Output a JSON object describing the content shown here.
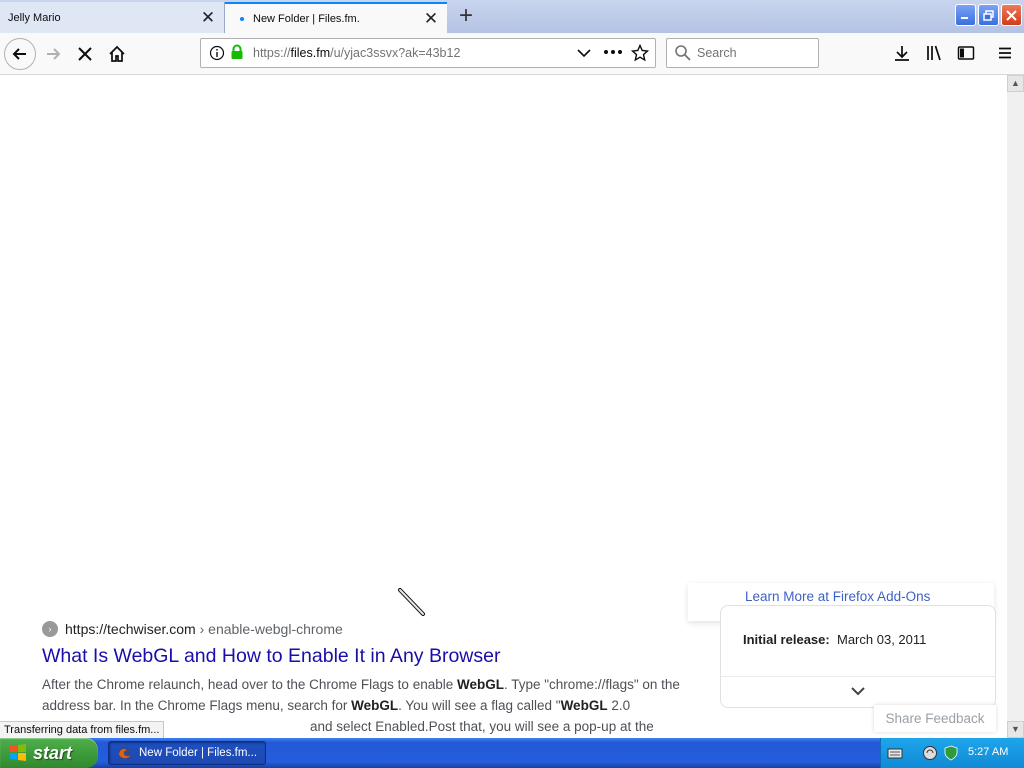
{
  "browser": {
    "tabs": [
      {
        "title": "Jelly Mario",
        "active": false
      },
      {
        "title": "New Folder | Files.fm.",
        "active": true,
        "loading": true
      }
    ],
    "url": {
      "prefix": "https://",
      "host": "files.fm",
      "path": "/u/yjac3ssvx?ak=43b12"
    },
    "search_placeholder": "Search",
    "status_text": "Transferring data from files.fm..."
  },
  "page": {
    "result": {
      "source": "https://techwiser.com",
      "breadcrumb": " › enable-webgl-chrome",
      "title": "What Is WebGL and How to Enable It in Any Browser",
      "snippet_parts": [
        {
          "text": "After the Chrome relaunch, head over to the Chrome Flags to enable ",
          "bold": false
        },
        {
          "text": "WebGL",
          "bold": true
        },
        {
          "text": ". Type \"chrome://flags\" on the address bar. In the Chrome Flags menu, search for ",
          "bold": false
        },
        {
          "text": "WebGL",
          "bold": true
        },
        {
          "text": ". You will see a flag called \"",
          "bold": false
        },
        {
          "text": "WebGL",
          "bold": true
        },
        {
          "text": " 2.0",
          "bold": false
        }
      ],
      "snippet_line3_tail": "and select Enabled.Post that, you will see a pop-up at the"
    },
    "knowledge_panel": {
      "label": "Initial release:",
      "value": "March 03, 2011"
    },
    "addons_link": "Learn More at Firefox Add-Ons",
    "share_feedback": "Share Feedback"
  },
  "taskbar": {
    "start_label": "start",
    "task_button_label": "New Folder | Files.fm...",
    "clock": "5:27 AM"
  },
  "colors": {
    "firefox_accent": "#0a84ff",
    "link_blue": "#1a0dab",
    "xp_taskbar": "#245edb",
    "xp_start_green": "#3a9a38"
  }
}
